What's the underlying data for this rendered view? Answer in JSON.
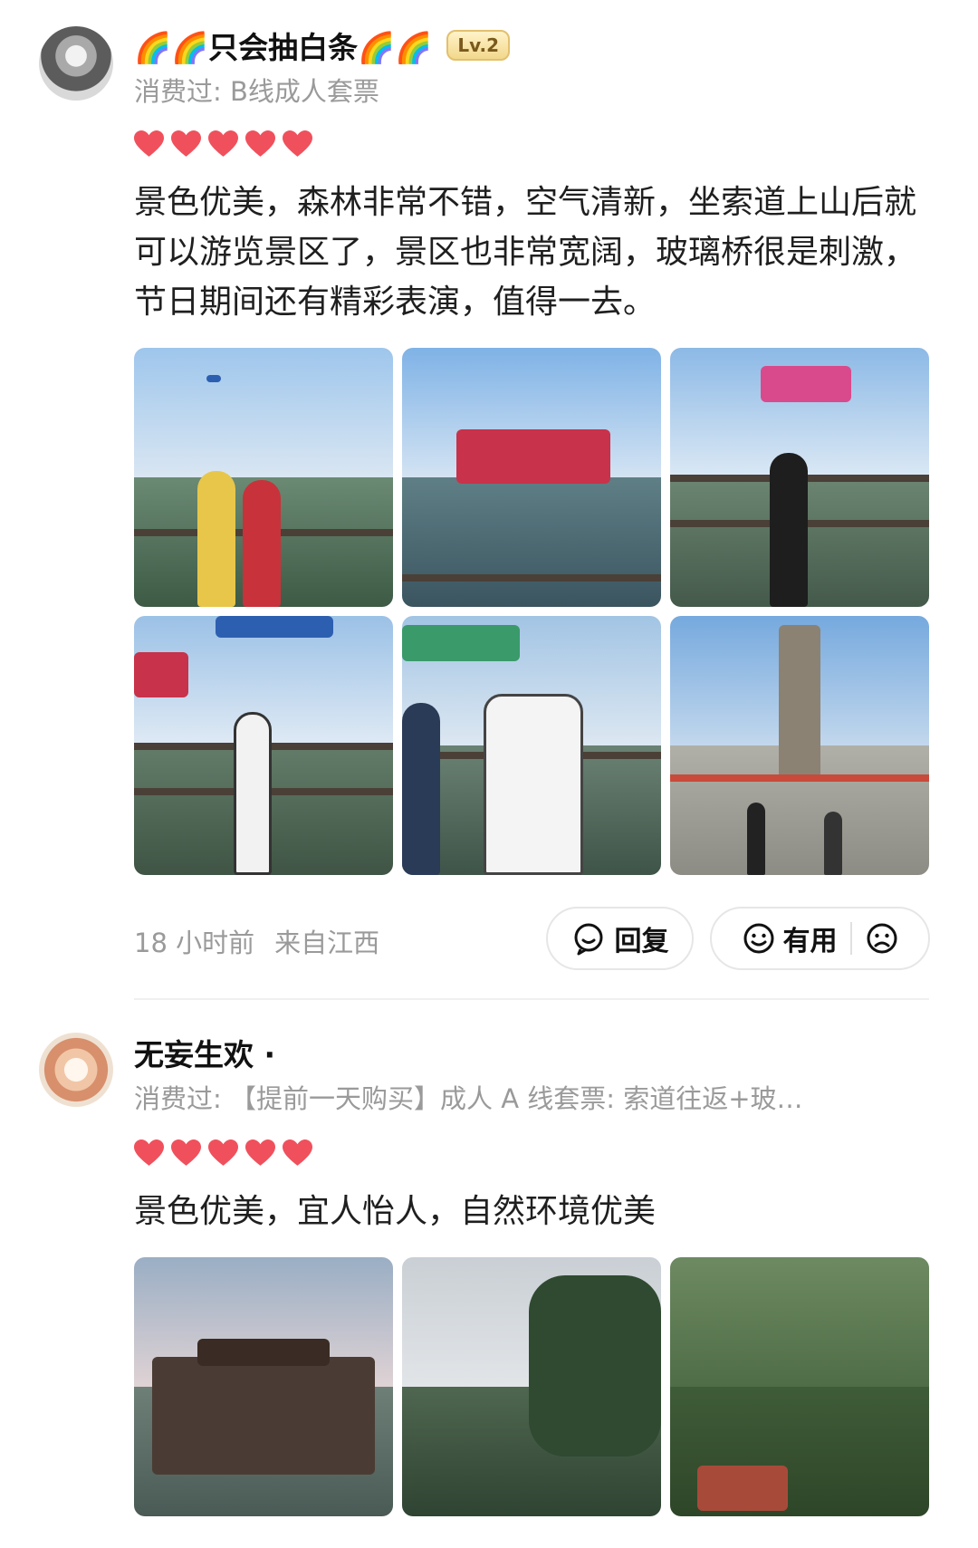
{
  "reviews": [
    {
      "username": "🌈🌈只会抽白条🌈🌈",
      "level": "Lv.2",
      "consumed": "消费过: B线成人套票",
      "rating": 5,
      "text": "景色优美，森林非常不错，空气清新，坐索道上山后就可以游览景区了，景区也非常宽阔，玻璃桥很是刺激，节日期间还有精彩表演，值得一去。",
      "time": "18 小时前",
      "location": "来自江西",
      "reply_label": "回复",
      "useful_label": "有用"
    },
    {
      "username": "无妄生欢 ·",
      "consumed": "消费过: 【提前一天购买】成人 A 线套票: 索道往返+玻…",
      "rating": 5,
      "text": "景色优美，宜人怡人，自然环境优美"
    }
  ],
  "colors": {
    "heart": "#f0505c",
    "muted_text": "#9a9a9a",
    "badge_gold": "#f2d88c"
  }
}
